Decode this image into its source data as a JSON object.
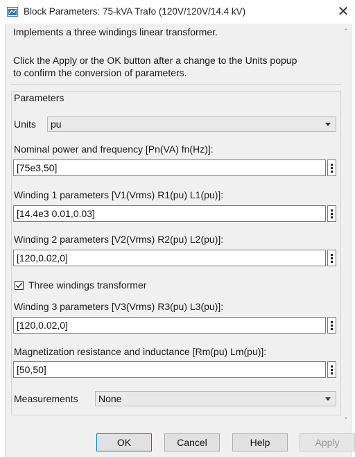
{
  "window": {
    "title": "Block Parameters: 75-kVA Trafo (120V/120V/14.4 kV)",
    "close_label": "✕"
  },
  "description": {
    "line1": "Implements a three windings linear transformer.",
    "line2": "Click the Apply or the OK button after a change to the Units popup",
    "line3": "to confirm the conversion of parameters."
  },
  "parameters": {
    "group_title": "Parameters",
    "units_label": "Units",
    "units_value": "pu",
    "nominal_label": "Nominal power and frequency [Pn(VA) fn(Hz)]:",
    "nominal_value": "[75e3,50]",
    "winding1_label": "Winding 1 parameters [V1(Vrms) R1(pu) L1(pu)]:",
    "winding1_value": "[14.4e3 0.01,0.03]",
    "winding2_label": "Winding 2 parameters [V2(Vrms) R2(pu) L2(pu)]:",
    "winding2_value": "[120,0.02,0]",
    "three_windings_label": "Three windings transformer",
    "three_windings_checked": true,
    "winding3_label": "Winding 3 parameters [V3(Vrms) R3(pu) L3(pu)]:",
    "winding3_value": "[120,0.02,0]",
    "magnetization_label": "Magnetization resistance and inductance [Rm(pu) Lm(pu)]:",
    "magnetization_value": "[50,50]",
    "measurements_label": "Measurements",
    "measurements_value": "None"
  },
  "buttons": {
    "ok": "OK",
    "cancel": "Cancel",
    "help": "Help",
    "apply": "Apply"
  },
  "icons": {
    "app": "simulink-block-icon",
    "checkbox": "checkmark-icon",
    "more": "vertical-ellipsis-icon",
    "dropdown": "chevron-down-icon"
  },
  "colors": {
    "dialog_bg": "#f0f0f0",
    "field_border": "#7a7a7a",
    "ok_border": "#0078d7"
  }
}
